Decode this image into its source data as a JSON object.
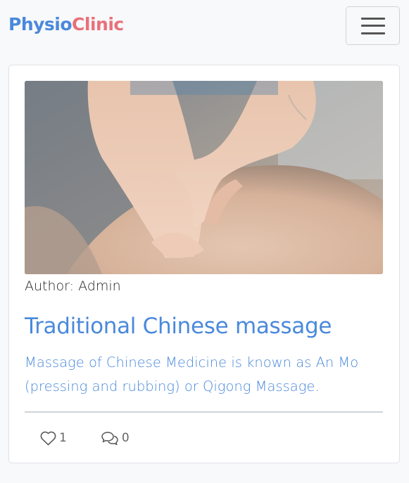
{
  "brand": {
    "part1": "Physio",
    "part2": "Clinic",
    "color1": "#4a89dc",
    "color2": "#e9707a"
  },
  "navbar": {
    "toggler_icon": "hamburger-icon"
  },
  "post": {
    "image_alt": "Massage on a patient's back",
    "author_label": "Author:",
    "author_name": "Admin",
    "title": "Traditional Chinese massage",
    "excerpt": "Massage of Chinese Medicine is known as An Mo (pressing and rubbing) or Qigong Massage.",
    "likes": {
      "icon": "heart-icon",
      "count": "1"
    },
    "comments": {
      "icon": "comments-icon",
      "count": "0"
    }
  },
  "colors": {
    "accent": "#4a89dc",
    "brand_secondary": "#e9707a",
    "background": "#f8f9fa"
  }
}
